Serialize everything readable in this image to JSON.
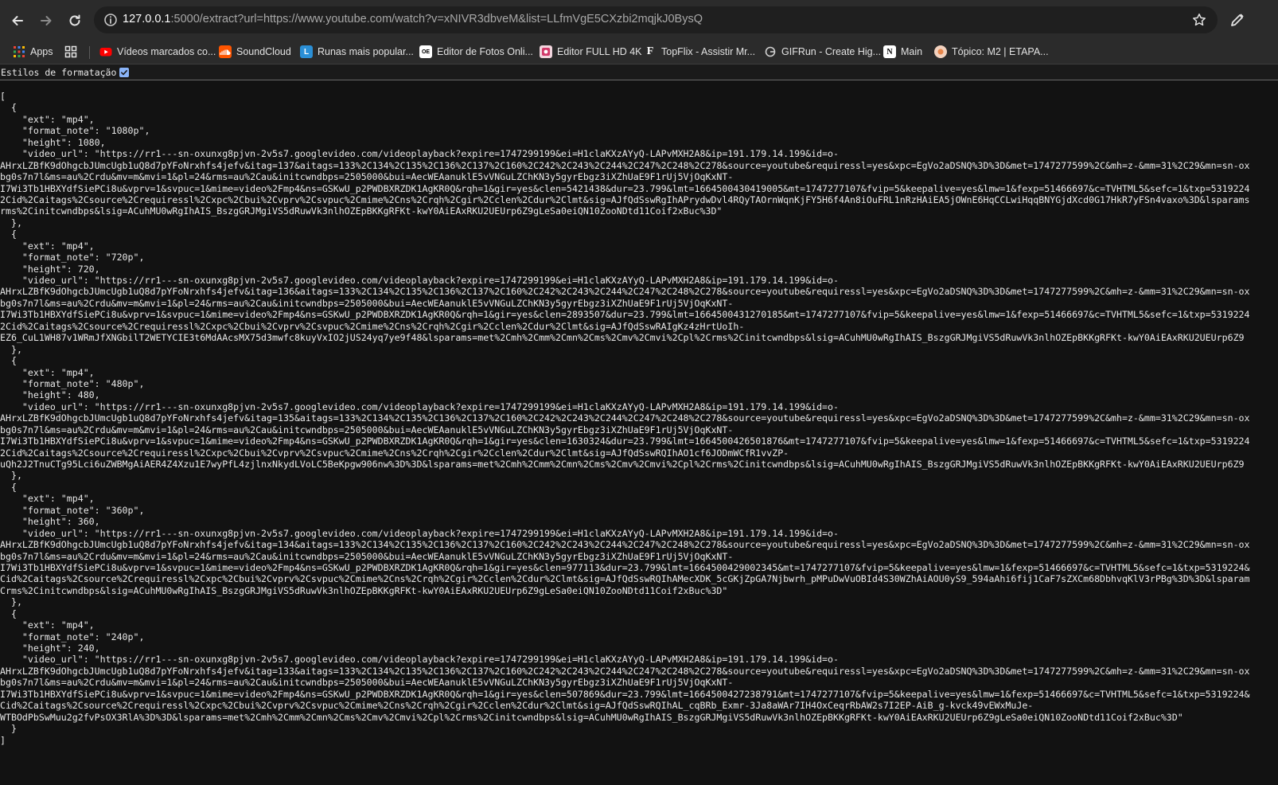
{
  "browser": {
    "url_host": "127.0.0.1",
    "url_rest": ":5000/extract?url=https://www.youtube.com/watch?v=xNIVR3dbveM&list=LLfmVgE5CXzbi2mqjkJ0BysQ",
    "icons": {
      "back": "arrow-left-icon",
      "forward": "arrow-right-icon",
      "reload": "reload-icon",
      "info": "info-icon",
      "star": "star-icon",
      "edit": "pen-icon"
    }
  },
  "bookmarks": [
    {
      "label": "Apps",
      "icon": "apps-grid-icon",
      "color": "#4285f4"
    },
    {
      "label": "",
      "icon": "tab-groups-icon",
      "color": "#e3e3e3"
    },
    {
      "label": "Vídeos marcados co...",
      "icon": "youtube-icon",
      "color": "#ff0000"
    },
    {
      "label": "SoundCloud",
      "icon": "soundcloud-icon",
      "color": "#ff5500"
    },
    {
      "label": "Runas mais popular...",
      "icon": "l-icon",
      "color": "#2b8fd6"
    },
    {
      "label": "Editor de Fotos Onli...",
      "icon": "photo-editor-icon",
      "color": "#ffffff"
    },
    {
      "label": "Editor FULL HD 4K",
      "icon": "editor-hd-icon",
      "color": "#d23a6a"
    },
    {
      "label": "TopFlix - Assistir Mr...",
      "icon": "topflix-icon",
      "color": "#ffffff"
    },
    {
      "label": "GIFRun - Create Hig...",
      "icon": "gifrun-icon",
      "color": "#cfcfcf"
    },
    {
      "label": "Main",
      "icon": "notion-icon",
      "color": "#ffffff"
    },
    {
      "label": "Tópico: M2 | ETAPA...",
      "icon": "topico-icon",
      "color": "#e8864a"
    }
  ],
  "viewer": {
    "pretty_print_label": "Estilos de formatação",
    "pretty_print_checked": true
  },
  "json_lines": [
    "[",
    "  {",
    "    \"ext\": \"mp4\",",
    "    \"format_note\": \"1080p\",",
    "    \"height\": 1080,",
    "    \"video_url\": \"https://rr1---sn-oxunxg8pjvn-2v5s7.googlevideo.com/videoplayback?expire=1747299199&ei=H1claKXzAYyQ-LAPvMXH2A8&ip=191.179.14.199&id=o-",
    "AHrxLZBfK9dOhgcbJUmcUgb1uQ8d7pYFoNrxhfs4jefv&itag=137&aitags=133%2C134%2C135%2C136%2C137%2C160%2C242%2C243%2C244%2C247%2C248%2C278&source=youtube&requiressl=yes&xpc=EgVo2aDSNQ%3D%3D&met=1747277599%2C&mh=z-&mm=31%2C29&mn=sn-ox",
    "bg0s7n7l&ms=au%2Crdu&mv=m&mvi=1&pl=24&rms=au%2Cau&initcwndbps=2505000&bui=AecWEAanuklE5vVNGuLZChKN3y5gyrEbgz3iXZhUaE9F1rUj5VjOqKxNT-",
    "I7Wi3Tb1HBXYdfSiePCi8u&vprv=1&svpuc=1&mime=video%2Fmp4&ns=GSKwU_p2PWDBXRZDK1AgKR0Q&rqh=1&gir=yes&clen=5421438&dur=23.799&lmt=1664500430419005&mt=1747277107&fvip=5&keepalive=yes&lmw=1&fexp=51466697&c=TVHTML5&sefc=1&txp=5319224",
    "2Cid%2Caitags%2Csource%2Crequiressl%2Cxpc%2Cbui%2Cvprv%2Csvpuc%2Cmime%2Cns%2Crqh%2Cgir%2Cclen%2Cdur%2Clmt&sig=AJfQdSswRgIhAPrydwDvl4RQyTAOrnWqnKjFY5H6f4An8iOuFRL1nRzHAiEA5jOWnE6HqCCLwiHqqBNYGjdXcd0G17HkR7yFSn4vaxo%3D&lsparams",
    "rms%2Cinitcwndbps&lsig=ACuhMU0wRgIhAIS_BszgGRJMgiVS5dRuwVk3nlhOZEpBKKgRFKt-kwY0AiEAxRKU2UEUrp6Z9gLeSa0eiQN10ZooNDtd11Coif2xBuc%3D\"",
    "  },",
    "  {",
    "    \"ext\": \"mp4\",",
    "    \"format_note\": \"720p\",",
    "    \"height\": 720,",
    "    \"video_url\": \"https://rr1---sn-oxunxg8pjvn-2v5s7.googlevideo.com/videoplayback?expire=1747299199&ei=H1claKXzAYyQ-LAPvMXH2A8&ip=191.179.14.199&id=o-",
    "AHrxLZBfK9dOhgcbJUmcUgb1uQ8d7pYFoNrxhfs4jefv&itag=136&aitags=133%2C134%2C135%2C136%2C137%2C160%2C242%2C243%2C244%2C247%2C248%2C278&source=youtube&requiressl=yes&xpc=EgVo2aDSNQ%3D%3D&met=1747277599%2C&mh=z-&mm=31%2C29&mn=sn-ox",
    "bg0s7n7l&ms=au%2Crdu&mv=m&mvi=1&pl=24&rms=au%2Cau&initcwndbps=2505000&bui=AecWEAanuklE5vVNGuLZChKN3y5gyrEbgz3iXZhUaE9F1rUj5VjOqKxNT-",
    "I7Wi3Tb1HBXYdfSiePCi8u&vprv=1&svpuc=1&mime=video%2Fmp4&ns=GSKwU_p2PWDBXRZDK1AgKR0Q&rqh=1&gir=yes&clen=2893507&dur=23.799&lmt=1664500431270185&mt=1747277107&fvip=5&keepalive=yes&lmw=1&fexp=51466697&c=TVHTML5&sefc=1&txp=5319224",
    "2Cid%2Caitags%2Csource%2Crequiressl%2Cxpc%2Cbui%2Cvprv%2Csvpuc%2Cmime%2Cns%2Crqh%2Cgir%2Cclen%2Cdur%2Clmt&sig=AJfQdSswRAIgKz4zHrtUoIh-",
    "EZ6_CuL1WH87v1WRmJfXNGbilT2WETYCIE3t6MdAAcsMX75d3mwfc8kuyVxIO2jUS24yq7ye9f48&lsparams=met%2Cmh%2Cmm%2Cmn%2Cms%2Cmv%2Cmvi%2Cpl%2Crms%2Cinitcwndbps&lsig=ACuhMU0wRgIhAIS_BszgGRJMgiVS5dRuwVk3nlhOZEpBKKgRFKt-kwY0AiEAxRKU2UEUrp6Z9",
    "  },",
    "  {",
    "    \"ext\": \"mp4\",",
    "    \"format_note\": \"480p\",",
    "    \"height\": 480,",
    "    \"video_url\": \"https://rr1---sn-oxunxg8pjvn-2v5s7.googlevideo.com/videoplayback?expire=1747299199&ei=H1claKXzAYyQ-LAPvMXH2A8&ip=191.179.14.199&id=o-",
    "AHrxLZBfK9dOhgcbJUmcUgb1uQ8d7pYFoNrxhfs4jefv&itag=135&aitags=133%2C134%2C135%2C136%2C137%2C160%2C242%2C243%2C244%2C247%2C248%2C278&source=youtube&requiressl=yes&xpc=EgVo2aDSNQ%3D%3D&met=1747277599%2C&mh=z-&mm=31%2C29&mn=sn-ox",
    "bg0s7n7l&ms=au%2Crdu&mv=m&mvi=1&pl=24&rms=au%2Cau&initcwndbps=2505000&bui=AecWEAanuklE5vVNGuLZChKN3y5gyrEbgz3iXZhUaE9F1rUj5VjOqKxNT-",
    "I7Wi3Tb1HBXYdfSiePCi8u&vprv=1&svpuc=1&mime=video%2Fmp4&ns=GSKwU_p2PWDBXRZDK1AgKR0Q&rqh=1&gir=yes&clen=1630324&dur=23.799&lmt=1664500426501876&mt=1747277107&fvip=5&keepalive=yes&lmw=1&fexp=51466697&c=TVHTML5&sefc=1&txp=5319224",
    "2Cid%2Caitags%2Csource%2Crequiressl%2Cxpc%2Cbui%2Cvprv%2Csvpuc%2Cmime%2Cns%2Crqh%2Cgir%2Cclen%2Cdur%2Clmt&sig=AJfQdSswRQIhAO1cf6JODmWCfR1vvZP-",
    "uQh2J2TnuCTg95Lci6uZWBMgAiAER4Z4Xzu1E7wyPfL4zjlnxNkydLVoLC5BeKpgw906nw%3D%3D&lsparams=met%2Cmh%2Cmm%2Cmn%2Cms%2Cmv%2Cmvi%2Cpl%2Crms%2Cinitcwndbps&lsig=ACuhMU0wRgIhAIS_BszgGRJMgiVS5dRuwVk3nlhOZEpBKKgRFKt-kwY0AiEAxRKU2UEUrp6Z9",
    "  },",
    "  {",
    "    \"ext\": \"mp4\",",
    "    \"format_note\": \"360p\",",
    "    \"height\": 360,",
    "    \"video_url\": \"https://rr1---sn-oxunxg8pjvn-2v5s7.googlevideo.com/videoplayback?expire=1747299199&ei=H1claKXzAYyQ-LAPvMXH2A8&ip=191.179.14.199&id=o-",
    "AHrxLZBfK9dOhgcbJUmcUgb1uQ8d7pYFoNrxhfs4jefv&itag=134&aitags=133%2C134%2C135%2C136%2C137%2C160%2C242%2C243%2C244%2C247%2C248%2C278&source=youtube&requiressl=yes&xpc=EgVo2aDSNQ%3D%3D&met=1747277599%2C&mh=z-&mm=31%2C29&mn=sn-ox",
    "bg0s7n7l&ms=au%2Crdu&mv=m&mvi=1&pl=24&rms=au%2Cau&initcwndbps=2505000&bui=AecWEAanuklE5vVNGuLZChKN3y5gyrEbgz3iXZhUaE9F1rUj5VjOqKxNT-",
    "I7Wi3Tb1HBXYdfSiePCi8u&vprv=1&svpuc=1&mime=video%2Fmp4&ns=GSKwU_p2PWDBXRZDK1AgKR0Q&rqh=1&gir=yes&clen=977113&dur=23.799&lmt=1664500429002345&mt=1747277107&fvip=5&keepalive=yes&lmw=1&fexp=51466697&c=TVHTML5&sefc=1&txp=5319224&",
    "Cid%2Caitags%2Csource%2Crequiressl%2Cxpc%2Cbui%2Cvprv%2Csvpuc%2Cmime%2Cns%2Crqh%2Cgir%2Cclen%2Cdur%2Clmt&sig=AJfQdSswRQIhAMecXDK_5cGKjZpGA7Njbwrh_pMPuDwVuOBId4S30WZhAiAOU0yS9_594aAhi6fij1CaF7sZXCm68DbhvqKlV3rPBg%3D%3D&lsparam",
    "Crms%2Cinitcwndbps&lsig=ACuhMU0wRgIhAIS_BszgGRJMgiVS5dRuwVk3nlhOZEpBKKgRFKt-kwY0AiEAxRKU2UEUrp6Z9gLeSa0eiQN10ZooNDtd11Coif2xBuc%3D\"",
    "  },",
    "  {",
    "    \"ext\": \"mp4\",",
    "    \"format_note\": \"240p\",",
    "    \"height\": 240,",
    "    \"video_url\": \"https://rr1---sn-oxunxg8pjvn-2v5s7.googlevideo.com/videoplayback?expire=1747299199&ei=H1claKXzAYyQ-LAPvMXH2A8&ip=191.179.14.199&id=o-",
    "AHrxLZBfK9dOhgcbJUmcUgb1uQ8d7pYFoNrxhfs4jefv&itag=133&aitags=133%2C134%2C135%2C136%2C137%2C160%2C242%2C243%2C244%2C247%2C248%2C278&source=youtube&requiressl=yes&xpc=EgVo2aDSNQ%3D%3D&met=1747277599%2C&mh=z-&mm=31%2C29&mn=sn-ox",
    "bg0s7n7l&ms=au%2Crdu&mv=m&mvi=1&pl=24&rms=au%2Cau&initcwndbps=2505000&bui=AecWEAanuklE5vVNGuLZChKN3y5gyrEbgz3iXZhUaE9F1rUj5VjOqKxNT-",
    "I7Wi3Tb1HBXYdfSiePCi8u&vprv=1&svpuc=1&mime=video%2Fmp4&ns=GSKwU_p2PWDBXRZDK1AgKR0Q&rqh=1&gir=yes&clen=507869&dur=23.799&lmt=1664500427238791&mt=1747277107&fvip=5&keepalive=yes&lmw=1&fexp=51466697&c=TVHTML5&sefc=1&txp=5319224&",
    "Cid%2Caitags%2Csource%2Crequiressl%2Cxpc%2Cbui%2Cvprv%2Csvpuc%2Cmime%2Cns%2Crqh%2Cgir%2Cclen%2Cdur%2Clmt&sig=AJfQdSswRQIhAL_cqBRb_Exmr-3Ja8aWAr7IH4OxCeqrRbAW2s7I2EP-AiB_g-kvck49vEWxMuJe-",
    "WTBOdPbSwMuu2g2fvPsOX3RlA%3D%3D&lsparams=met%2Cmh%2Cmm%2Cmn%2Cms%2Cmv%2Cmvi%2Cpl%2Crms%2Cinitcwndbps&lsig=ACuhMU0wRgIhAIS_BszgGRJMgiVS5dRuwVk3nlhOZEpBKKgRFKt-kwY0AiEAxRKU2UEUrp6Z9gLeSa0eiQN10ZooNDtd11Coif2xBuc%3D\"",
    "  }",
    "]"
  ]
}
